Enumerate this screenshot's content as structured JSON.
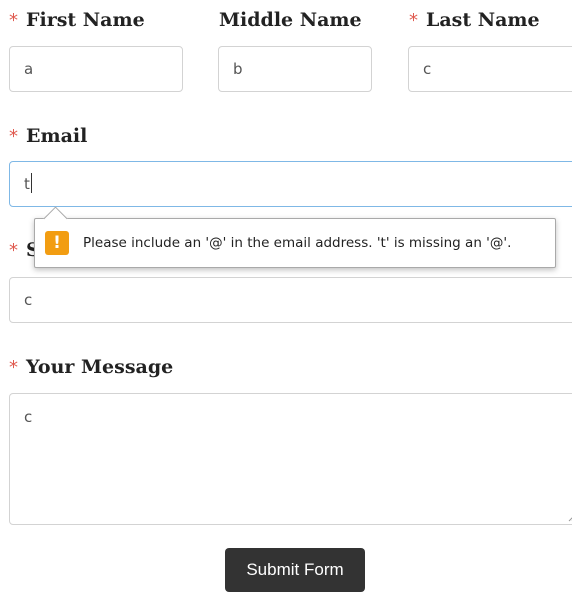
{
  "form": {
    "required_marker": "*",
    "fields": {
      "first_name": {
        "label": "First Name",
        "value": "a",
        "required": true
      },
      "middle_name": {
        "label": "Middle Name",
        "value": "b",
        "required": false
      },
      "last_name": {
        "label": "Last Name",
        "value": "c",
        "required": true
      },
      "email": {
        "label": "Email",
        "value": "t",
        "required": true,
        "focused": true
      },
      "subject": {
        "label": "S",
        "value": "c",
        "required": true
      },
      "message": {
        "label": "Your Message",
        "value": "c",
        "required": true
      }
    },
    "validation_tooltip": {
      "icon": "warning-icon",
      "icon_glyph": "!",
      "text": "Please include an '@' in the email address. 't' is missing an '@'."
    },
    "submit_label": "Submit Form"
  },
  "colors": {
    "required_marker": "#e05a4f",
    "focus_border": "#7fb8e6",
    "warning": "#f29d12",
    "button_bg": "#333333"
  }
}
